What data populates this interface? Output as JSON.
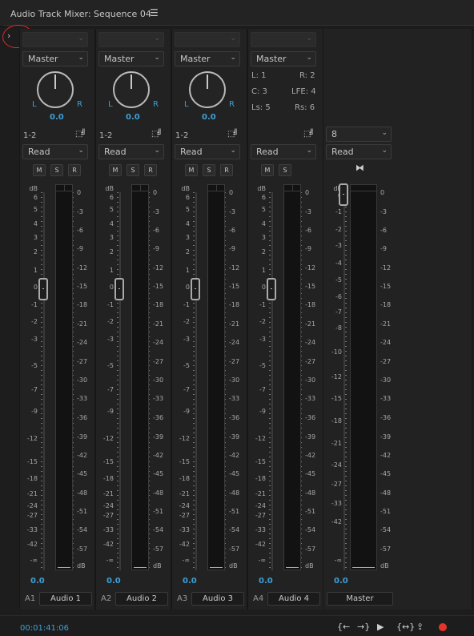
{
  "panel": {
    "title": "Audio Track Mixer: Sequence 04",
    "menu_icon": "hamburger-icon",
    "expand_icon": "chevron-right-icon"
  },
  "scale_left": [
    "dB",
    "6",
    "5",
    "4",
    "3",
    "2",
    "1",
    "0",
    "-1",
    "-2",
    "-3",
    "-5",
    "-7",
    "-9",
    "-12",
    "-15",
    "-18",
    "-21",
    "-24",
    "-27",
    "-33",
    "-42",
    "-∞"
  ],
  "scale_right": [
    "0",
    "-3",
    "-6",
    "-9",
    "-12",
    "-15",
    "-18",
    "-21",
    "-24",
    "-27",
    "-30",
    "-33",
    "-36",
    "-39",
    "-42",
    "-45",
    "-48",
    "-51",
    "-54",
    "-57",
    "dB"
  ],
  "master_scale_left": [
    "dB",
    "0",
    "-1",
    "-2",
    "-3",
    "-4",
    "-5",
    "-6",
    "-7",
    "-8",
    "-10",
    "-12",
    "-15",
    "-18",
    "-21",
    "-24",
    "-27",
    "-33",
    "-42",
    "-∞"
  ],
  "tracks": [
    {
      "id": "A1",
      "name": "Audio 1",
      "output": "Master",
      "routing": "1-2",
      "mode": "Read",
      "pan_value": "0.0",
      "pan_left": "L",
      "pan_right": "R",
      "volume_value": "0.0",
      "buttons": [
        "M",
        "S",
        "R"
      ]
    },
    {
      "id": "A2",
      "name": "Audio 2",
      "output": "Master",
      "routing": "1-2",
      "mode": "Read",
      "pan_value": "0.0",
      "pan_left": "L",
      "pan_right": "R",
      "volume_value": "0.0",
      "buttons": [
        "M",
        "S",
        "R"
      ]
    },
    {
      "id": "A3",
      "name": "Audio 3",
      "output": "Master",
      "routing": "1-2",
      "mode": "Read",
      "pan_value": "0.0",
      "pan_left": "L",
      "pan_right": "R",
      "volume_value": "0.0",
      "buttons": [
        "M",
        "S",
        "R"
      ]
    },
    {
      "id": "A4",
      "name": "Audio 4",
      "output": "Master",
      "mode": "Read",
      "volume_value": "0.0",
      "buttons": [
        "M",
        "S"
      ],
      "surround": {
        "l": "L: 1",
        "r": "R: 2",
        "c": "C: 3",
        "lfe": "LFE: 4",
        "ls": "Ls: 5",
        "rs": "Rs: 6"
      }
    }
  ],
  "master": {
    "name": "Master",
    "channels": "8",
    "mode": "Read",
    "volume_value": "0.0"
  },
  "footer": {
    "timecode": "00:01:41:06",
    "transport": [
      "go-to-in-icon",
      "go-to-out-icon",
      "play-icon",
      "loop-icon",
      "export-icon",
      "record-icon"
    ],
    "record_color": "#e5352b"
  },
  "colors": {
    "accent": "#3d9fd8",
    "annotation": "#d82a2a"
  }
}
